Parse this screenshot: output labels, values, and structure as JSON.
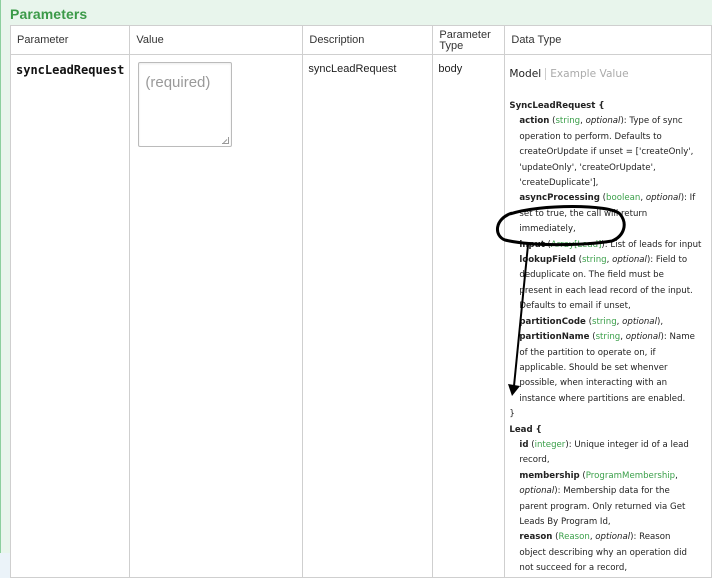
{
  "panel": {
    "title": "Parameters"
  },
  "table": {
    "headers": [
      "Parameter",
      "Value",
      "Description",
      "Parameter Type",
      "Data Type"
    ],
    "headers_ptype_lines": [
      "Parameter",
      "Type"
    ]
  },
  "row": {
    "name": "syncLeadRequest",
    "value_placeholder": "(required)",
    "description": "syncLeadRequest",
    "param_type": "body"
  },
  "datatype": {
    "tab_model": "Model",
    "tab_example": "Example Value",
    "sync_title": "SyncLeadRequest {",
    "lines_sync": [
      "action (string, optional): Type of sync",
      "operation to perform. Defaults to",
      "createOrUpdate if unset = ['createOnly',",
      "'updateOnly', 'createOrUpdate',",
      "'createDuplicate'],",
      "asyncProcessing (boolean, optional): If",
      "set to true, the call will return",
      "immediately,",
      "input (Array[Lead]): List of leads for input",
      "lookupField (string, optional): Field to",
      "deduplicate on. The field must be",
      "present in each lead record of the input.",
      "Defaults to email if unset,",
      "partitionCode (string, optional),",
      "partitionName (string, optional): Name",
      "of the partition to operate on, if",
      "applicable. Should be set whenver",
      "possible, when interacting with an",
      "instance where partitions are enabled."
    ],
    "sync_close": "}",
    "lead_title": "Lead {",
    "lines_lead": [
      "id (integer): Unique integer id of a lead",
      "record,",
      "membership (ProgramMembership,",
      "optional): Membership data for the",
      "parent program. Only returned via Get",
      "Leads By Program Id,",
      "reason (Reason, optional): Reason",
      "object describing why an operation did",
      "not succeed for a record,"
    ]
  },
  "colors": {
    "accent_green": "#3a9f49",
    "panel_bg": "#e8f5ec",
    "title_green": "#3b9a48"
  }
}
